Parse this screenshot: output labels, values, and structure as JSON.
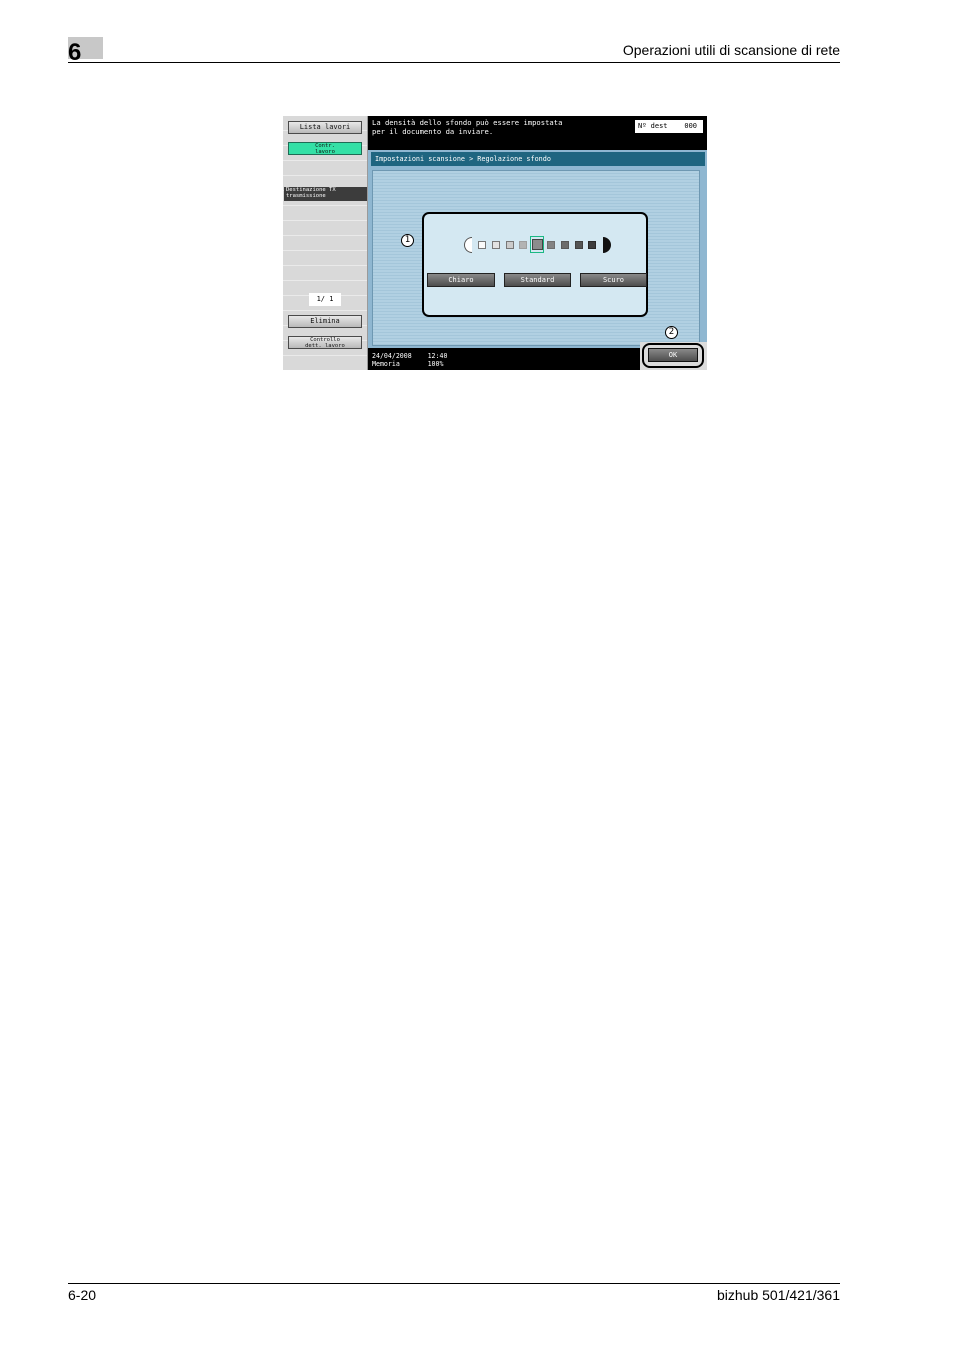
{
  "page": {
    "chapter_number": "6",
    "header_title": "Operazioni utili di scansione di rete",
    "footer_page": "6-20",
    "footer_product": "bizhub 501/421/361"
  },
  "screen": {
    "left_panel": {
      "job_list_button": "Lista lavori",
      "job_details_button": "Contr.\nlavoro",
      "destination_label": "Destinazione TX\ntrasmissione",
      "page_counter": "1/ 1",
      "delete_button": "Elimina",
      "job_check_button": "Controllo\ndett. lavoro"
    },
    "message": "La densità dello sfondo può essere impostata\nper il documento da inviare.",
    "dest_count": "Nº dest    000",
    "breadcrumb": "Impostazioni scansione > Regolazione sfondo",
    "density": {
      "levels": 9,
      "selected_level": 5,
      "buttons": [
        "Chiaro",
        "Standard",
        "Scuro"
      ]
    },
    "callouts": [
      "1",
      "2"
    ],
    "status": "24/04/2008    12:40\nMemoria       100%",
    "ok_button": "OK"
  },
  "colors": {
    "accent_green": "#34e0a6",
    "panel_blue": "#8fb7d1",
    "breadcrumb_bar": "#1f6580"
  }
}
